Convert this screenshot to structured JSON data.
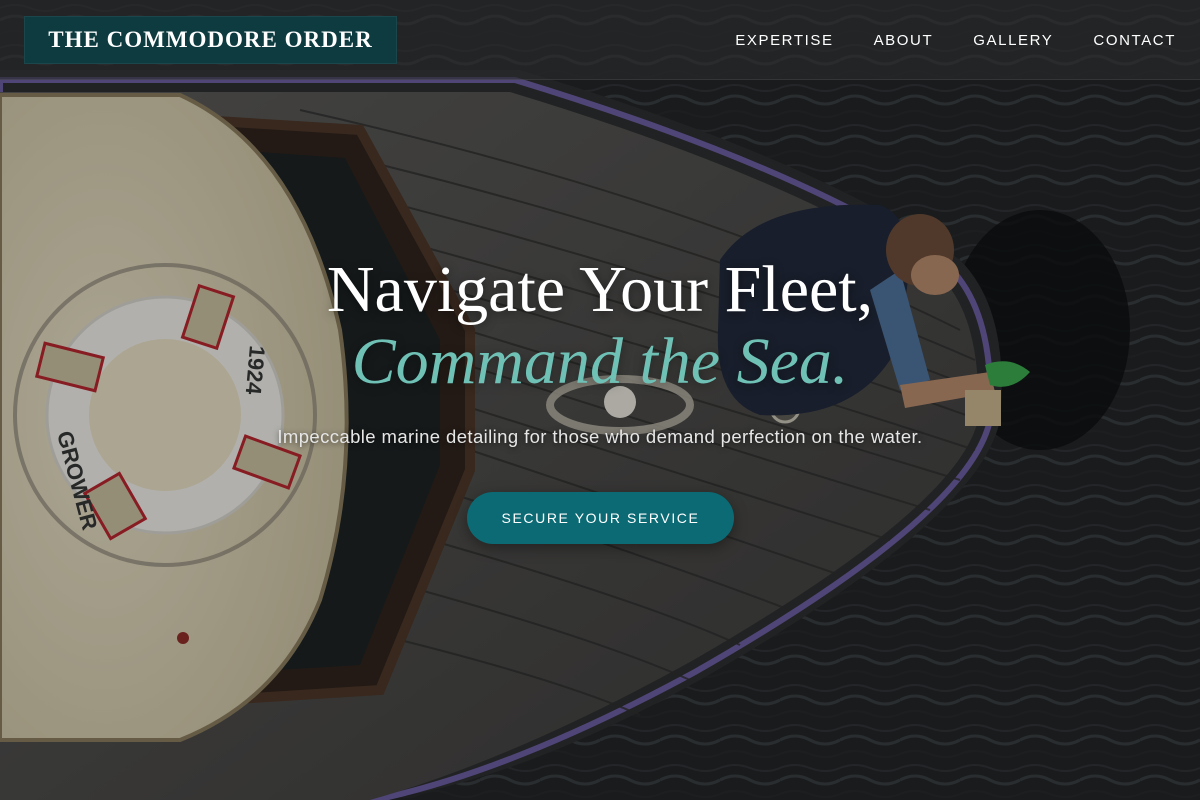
{
  "brand": {
    "name": "THE COMMODORE ORDER"
  },
  "nav": {
    "items": [
      "EXPERTISE",
      "ABOUT",
      "GALLERY",
      "CONTACT"
    ]
  },
  "hero": {
    "headline_line1": "Navigate Your Fleet,",
    "headline_line2": "Command the Sea.",
    "subtitle": "Impeccable marine detailing for those who demand perfection on the water.",
    "cta_label": "SECURE YOUR SERVICE"
  },
  "life_ring": {
    "text_left": "GROWER",
    "text_right": "1924"
  },
  "colors": {
    "header_bg": "#2a2c2e",
    "logo_bg": "#0d3b40",
    "accent_teal": "#6fc1b6",
    "cta_bg": "#0b6a74",
    "text_light": "#ffffff"
  }
}
